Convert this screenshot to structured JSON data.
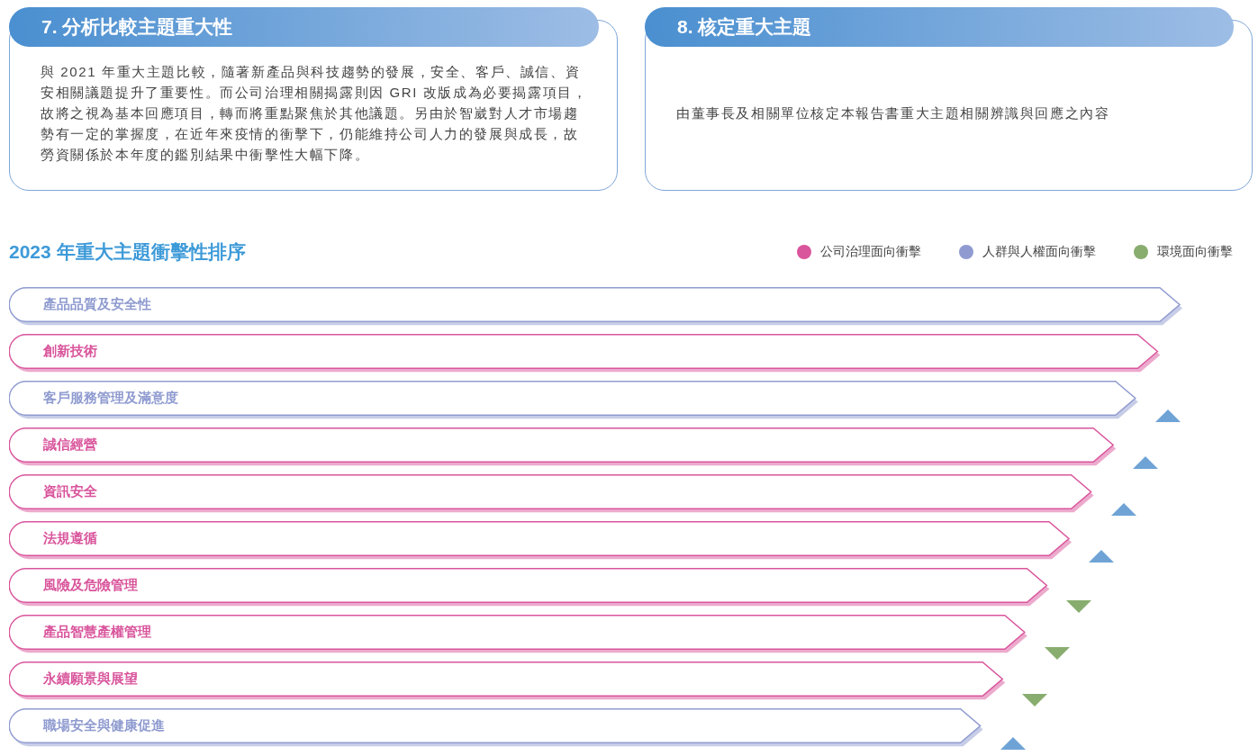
{
  "cards": [
    {
      "title": "7. 分析比較主題重大性",
      "body": "與 2021 年重大主題比較，隨著新產品與科技趨勢的發展，安全、客戶、誠信、資安相關議題提升了重要性。而公司治理相關揭露則因 GRI 改版成為必要揭露項目，故將之視為基本回應項目，轉而將重點聚焦於其他議題。另由於智崴對人才市場趨勢有一定的掌握度，在近年來疫情的衝擊下，仍能維持公司人力的發展與成長，故勞資關係於本年度的鑑別結果中衝擊性大幅下降。"
    },
    {
      "title": "8. 核定重大主題",
      "body": "由董事長及相關單位核定本報告書重大主題相關辨識與回應之內容"
    }
  ],
  "ranking": {
    "title": "2023 年重大主題衝擊性排序",
    "legend": [
      {
        "label": "公司治理面向衝擊",
        "color": "#d9559c"
      },
      {
        "label": "人群與人權面向衝擊",
        "color": "#8f9bd0"
      },
      {
        "label": "環境面向衝擊",
        "color": "#88ad6f"
      }
    ],
    "topics": [
      {
        "label": "產品品質及安全性",
        "color": "#8f9bd0",
        "kind": "steady"
      },
      {
        "label": "創新技術",
        "color": "#d9559c",
        "kind": "steady"
      },
      {
        "label": "客戶服務管理及滿意度",
        "color": "#8f9bd0",
        "kind": "rising"
      },
      {
        "label": "誠信經營",
        "color": "#d9559c",
        "kind": "rising"
      },
      {
        "label": "資訊安全",
        "color": "#d9559c",
        "kind": "rising"
      },
      {
        "label": "法規遵循",
        "color": "#d9559c",
        "kind": "rising"
      },
      {
        "label": "風險及危險管理",
        "color": "#d9559c",
        "kind": "falling"
      },
      {
        "label": "產品智慧產權管理",
        "color": "#d9559c",
        "kind": "falling"
      },
      {
        "label": "永續願景與展望",
        "color": "#d9559c",
        "kind": "falling"
      },
      {
        "label": "職場安全與健康促進",
        "color": "#8f9bd0",
        "kind": "rising"
      }
    ]
  }
}
